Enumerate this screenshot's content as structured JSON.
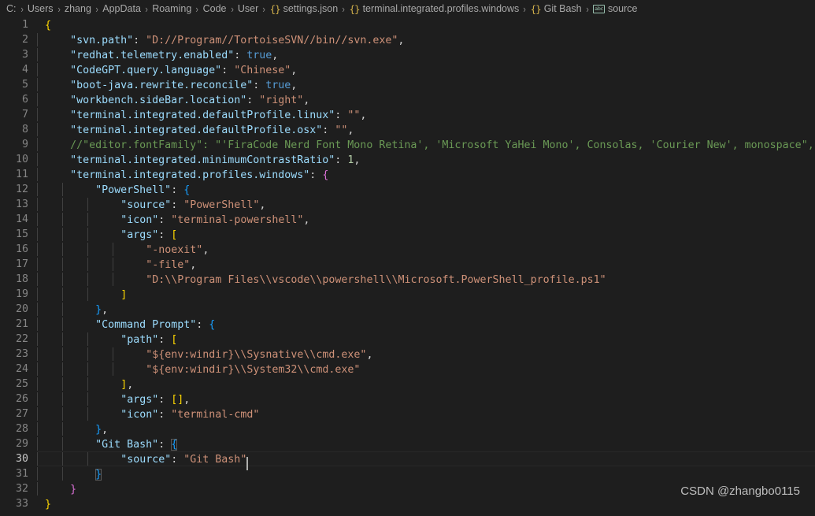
{
  "theme": {
    "background": "#1e1e1e",
    "line_number_color": "#858585",
    "active_line_number_color": "#c6c6c6",
    "key_color": "#9cdcfe",
    "string_color": "#ce9178",
    "boolean_color": "#569cd6",
    "number_color": "#b5cea8",
    "comment_color": "#6a9955",
    "bracket_level1_color": "#ffd700",
    "bracket_level2_color": "#da70d6",
    "bracket_level3_color": "#179fff",
    "punctuation_color": "#d4d4d4",
    "indent_guide_color": "#404040",
    "cursor_color": "#aeafad"
  },
  "breadcrumb": {
    "items": [
      {
        "label": "C:",
        "icon": null
      },
      {
        "label": "Users",
        "icon": null
      },
      {
        "label": "zhang",
        "icon": null
      },
      {
        "label": "AppData",
        "icon": null
      },
      {
        "label": "Roaming",
        "icon": null
      },
      {
        "label": "Code",
        "icon": null
      },
      {
        "label": "User",
        "icon": null
      },
      {
        "label": "settings.json",
        "icon": "braces-icon"
      },
      {
        "label": "terminal.integrated.profiles.windows",
        "icon": "braces-icon"
      },
      {
        "label": "Git Bash",
        "icon": "braces-icon"
      },
      {
        "label": "source",
        "icon": "string-symbol-icon"
      }
    ],
    "separator": "›",
    "braces_glyph": "{}",
    "string_glyph": "abc"
  },
  "editor": {
    "language": "jsonc",
    "active_line": 30,
    "cursor_line": 30,
    "cursor_column": 31,
    "total_lines": 33,
    "lines": [
      {
        "n": "1",
        "text": "{"
      },
      {
        "n": "2",
        "text": "    \"svn.path\": \"D://Program//TortoiseSVN//bin//svn.exe\","
      },
      {
        "n": "3",
        "text": "    \"redhat.telemetry.enabled\": true,"
      },
      {
        "n": "4",
        "text": "    \"CodeGPT.query.language\": \"Chinese\","
      },
      {
        "n": "5",
        "text": "    \"boot-java.rewrite.reconcile\": true,"
      },
      {
        "n": "6",
        "text": "    \"workbench.sideBar.location\": \"right\","
      },
      {
        "n": "7",
        "text": "    \"terminal.integrated.defaultProfile.linux\": \"\","
      },
      {
        "n": "8",
        "text": "    \"terminal.integrated.defaultProfile.osx\": \"\","
      },
      {
        "n": "9",
        "text": "    //\"editor.fontFamily\": \"'FiraCode Nerd Font Mono Retina', 'Microsoft YaHei Mono', Consolas, 'Courier New', monospace\","
      },
      {
        "n": "10",
        "text": "    \"terminal.integrated.minimumContrastRatio\": 1,"
      },
      {
        "n": "11",
        "text": "    \"terminal.integrated.profiles.windows\": {"
      },
      {
        "n": "12",
        "text": "        \"PowerShell\": {"
      },
      {
        "n": "13",
        "text": "            \"source\": \"PowerShell\","
      },
      {
        "n": "14",
        "text": "            \"icon\": \"terminal-powershell\","
      },
      {
        "n": "15",
        "text": "            \"args\": ["
      },
      {
        "n": "16",
        "text": "                \"-noexit\","
      },
      {
        "n": "17",
        "text": "                \"-file\","
      },
      {
        "n": "18",
        "text": "                \"D:\\\\Program Files\\\\vscode\\\\powershell\\\\Microsoft.PowerShell_profile.ps1\""
      },
      {
        "n": "19",
        "text": "            ]"
      },
      {
        "n": "20",
        "text": "        },"
      },
      {
        "n": "21",
        "text": "        \"Command Prompt\": {"
      },
      {
        "n": "22",
        "text": "            \"path\": ["
      },
      {
        "n": "23",
        "text": "                \"${env:windir}\\\\Sysnative\\\\cmd.exe\","
      },
      {
        "n": "24",
        "text": "                \"${env:windir}\\\\System32\\\\cmd.exe\""
      },
      {
        "n": "25",
        "text": "            ],"
      },
      {
        "n": "26",
        "text": "            \"args\": [],"
      },
      {
        "n": "27",
        "text": "            \"icon\": \"terminal-cmd\""
      },
      {
        "n": "28",
        "text": "        },"
      },
      {
        "n": "29",
        "text": "        \"Git Bash\": {"
      },
      {
        "n": "30",
        "text": "            \"source\": \"Git Bash\""
      },
      {
        "n": "31",
        "text": "        }"
      },
      {
        "n": "32",
        "text": "    }"
      },
      {
        "n": "33",
        "text": "}"
      }
    ]
  },
  "watermark": {
    "text": "CSDN @zhangbo0115"
  }
}
